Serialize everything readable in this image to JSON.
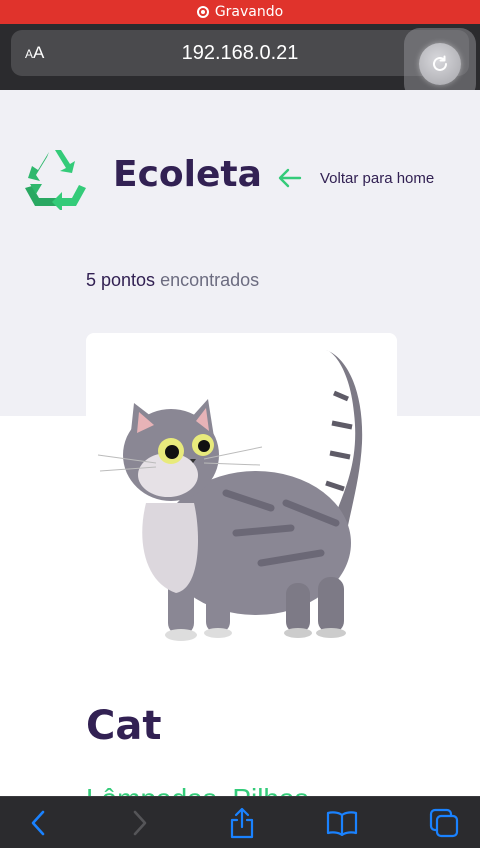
{
  "status_bar": {
    "recording_label": "Gravando"
  },
  "browser": {
    "text_size_label": "AA",
    "url": "192.168.0.21"
  },
  "header": {
    "brand": "Ecoleta",
    "back_label": "Voltar para home"
  },
  "results": {
    "count": "5 pontos",
    "suffix": " encontrados"
  },
  "point": {
    "name": "Cat",
    "items": "Lâmpadas, Pilhas"
  },
  "colors": {
    "primary": "#34cb79",
    "title": "#322153",
    "accent_blue": "#1a82ff",
    "rec_red": "#e0332c"
  },
  "icons": [
    "recording-icon",
    "recycle-icon",
    "arrow-left-icon",
    "reload-icon",
    "back-icon",
    "forward-icon",
    "share-icon",
    "bookmarks-icon",
    "tabs-icon"
  ]
}
